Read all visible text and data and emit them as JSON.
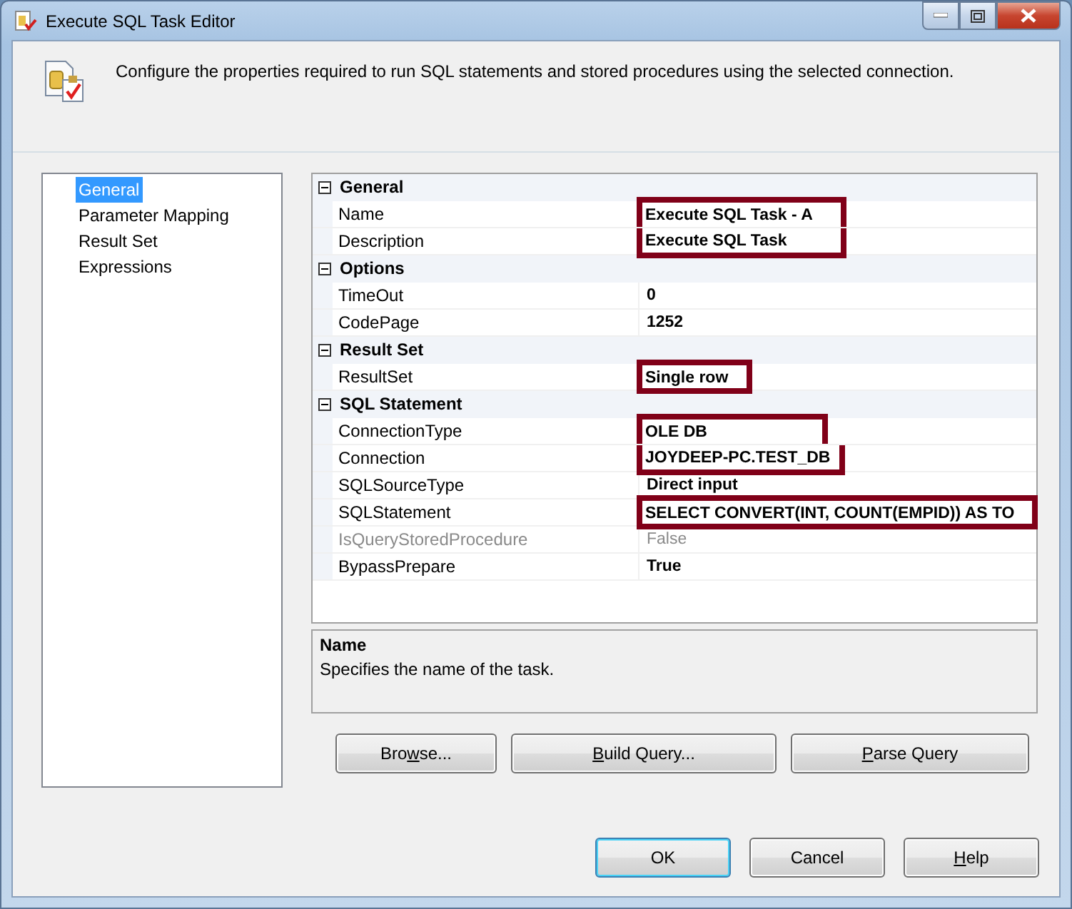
{
  "window": {
    "title": "Execute SQL Task Editor"
  },
  "header": {
    "text": "Configure the properties required to run SQL statements and stored procedures using the selected connection."
  },
  "sidebar": {
    "items": [
      {
        "label": "General",
        "selected": true
      },
      {
        "label": "Parameter Mapping",
        "selected": false
      },
      {
        "label": "Result Set",
        "selected": false
      },
      {
        "label": "Expressions",
        "selected": false
      }
    ]
  },
  "properties": [
    {
      "category": "General",
      "expanded": true,
      "rows": [
        {
          "name": "Name",
          "value": "Execute SQL Task - A",
          "disabled": false,
          "highlighted": true
        },
        {
          "name": "Description",
          "value": "Execute SQL Task",
          "disabled": false,
          "highlighted": true
        }
      ]
    },
    {
      "category": "Options",
      "expanded": true,
      "rows": [
        {
          "name": "TimeOut",
          "value": "0",
          "disabled": false,
          "highlighted": false
        },
        {
          "name": "CodePage",
          "value": "1252",
          "disabled": false,
          "highlighted": false
        }
      ]
    },
    {
      "category": "Result Set",
      "expanded": true,
      "rows": [
        {
          "name": "ResultSet",
          "value": "Single row",
          "disabled": false,
          "highlighted": true
        }
      ]
    },
    {
      "category": "SQL Statement",
      "expanded": true,
      "rows": [
        {
          "name": "ConnectionType",
          "value": "OLE DB",
          "disabled": false,
          "highlighted": true
        },
        {
          "name": "Connection",
          "value": "JOYDEEP-PC.TEST_DB",
          "disabled": false,
          "highlighted": true
        },
        {
          "name": "SQLSourceType",
          "value": "Direct input",
          "disabled": false,
          "highlighted": false
        },
        {
          "name": "SQLStatement",
          "value": "SELECT  CONVERT(INT, COUNT(EMPID)) AS TO",
          "disabled": false,
          "highlighted": true
        },
        {
          "name": "IsQueryStoredProcedure",
          "value": "False",
          "disabled": true,
          "highlighted": false
        },
        {
          "name": "BypassPrepare",
          "value": "True",
          "disabled": false,
          "highlighted": false
        }
      ]
    }
  ],
  "description": {
    "title": "Name",
    "text": "Specifies the name of the task."
  },
  "query_buttons": [
    {
      "pre": "Bro",
      "key": "w",
      "post": "se..."
    },
    {
      "key": "B",
      "post": "uild Query..."
    },
    {
      "key": "P",
      "post": "arse Query"
    }
  ],
  "dialog_buttons": [
    {
      "pre": "OK",
      "default": true
    },
    {
      "pre": "Cancel",
      "default": false
    },
    {
      "key": "H",
      "post": "elp",
      "default": false
    }
  ]
}
